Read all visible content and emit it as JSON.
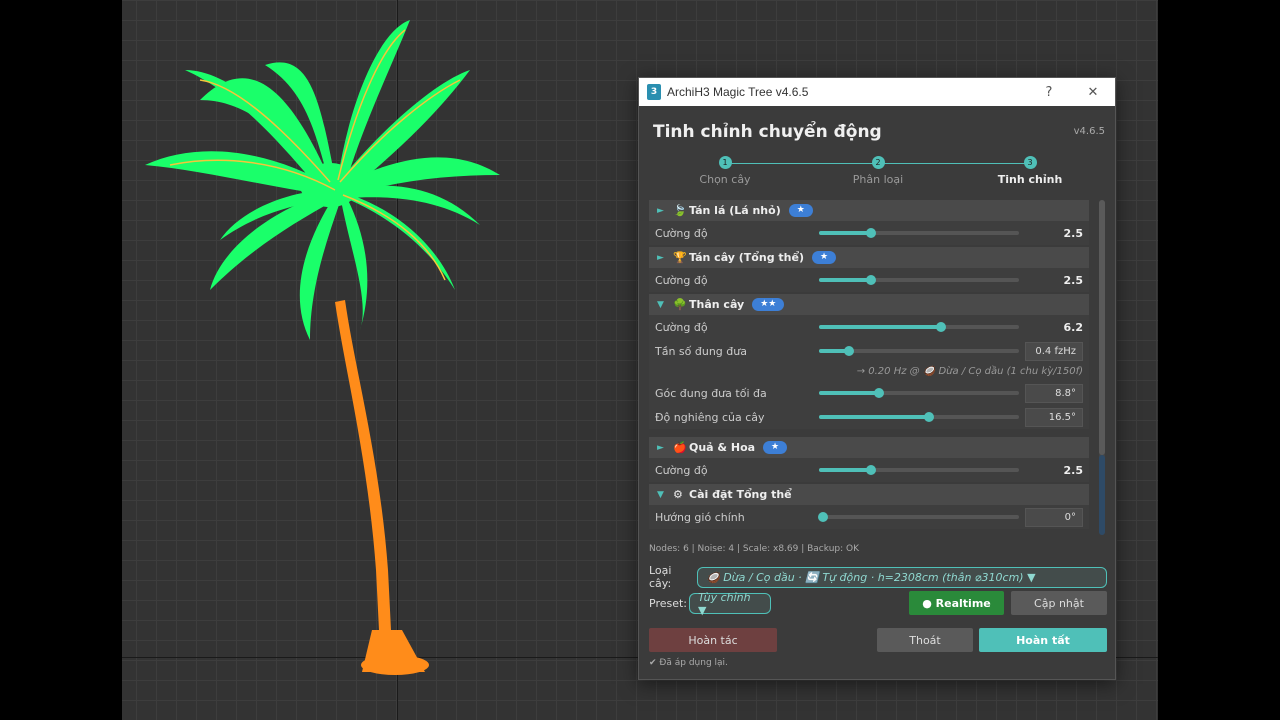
{
  "window": {
    "title": "ArchiH3 Magic Tree v4.6.5",
    "help_glyph": "?",
    "close_glyph": "✕",
    "app_icon_text": "3"
  },
  "header": {
    "title": "Tinh chỉnh chuyển động",
    "version": "v4.6.5"
  },
  "steps": [
    {
      "num": "1",
      "label": "Chọn cây"
    },
    {
      "num": "2",
      "label": "Phân loại"
    },
    {
      "num": "3",
      "label": "Tinh chỉnh"
    }
  ],
  "sections": {
    "leaves": {
      "title": "Tán lá (Lá nhỏ)",
      "stars": "★",
      "icon": "leaf-icon",
      "rows": {
        "strength_label": "Cường độ",
        "strength_value": "2.5"
      }
    },
    "canopy": {
      "title": "Tán cây (Tổng thể)",
      "stars": "★",
      "icon": "canopy-icon",
      "rows": {
        "strength_label": "Cường độ",
        "strength_value": "2.5"
      }
    },
    "trunk": {
      "title": "Thân cây",
      "stars": "★★",
      "icon": "tree-icon",
      "strength_label": "Cường độ",
      "strength_value": "6.2",
      "freq_label": "Tần số đung đưa",
      "freq_value": "0.4 fzHz",
      "freq_note": "→ 0.20 Hz @ 🥥 Dừa / Cọ dầu (1 chu kỳ/150f)",
      "angle_label": "Góc đung đưa tối đa",
      "angle_value": "8.8°",
      "tilt_label": "Độ nghiêng của cây",
      "tilt_value": "16.5°"
    },
    "fruit": {
      "title": "Quả & Hoa",
      "stars": "★",
      "icon": "fruit-icon",
      "strength_label": "Cường độ",
      "strength_value": "2.5"
    },
    "global": {
      "title": "Cài đặt Tổng thể",
      "icon": "gear-icon",
      "wind_label": "Hướng gió chính",
      "wind_value": "0°"
    }
  },
  "sliders": {
    "leaves": 0.26,
    "canopy": 0.26,
    "trunk_strength": 0.61,
    "trunk_freq": 0.15,
    "trunk_angle": 0.3,
    "trunk_tilt": 0.55,
    "fruit": 0.26,
    "wind": 0.02
  },
  "stats": "Nodes: 6 | Noise: 4 | Scale: x8.69 | Backup: OK",
  "tree_type": {
    "label": "Loại cây:",
    "value": "🥥 Dừa / Cọ dầu  ·  🔄 Tự động  ·  h=2308cm (thân ⌀310cm) ▼"
  },
  "preset": {
    "label": "Preset:",
    "value": "Tùy chỉnh ▼"
  },
  "buttons": {
    "realtime": "● Realtime",
    "update": "Cập nhật",
    "undo": "Hoàn tác",
    "exit": "Thoát",
    "finish": "Hoàn tất"
  },
  "status": "✔ Đã áp dụng lại.",
  "colors": {
    "accent": "#4fc0b8",
    "foliage": "#1aff6a",
    "trunk": "#ff8c1a",
    "realtime": "#2a8a3a",
    "badge": "#3d7fd6"
  }
}
